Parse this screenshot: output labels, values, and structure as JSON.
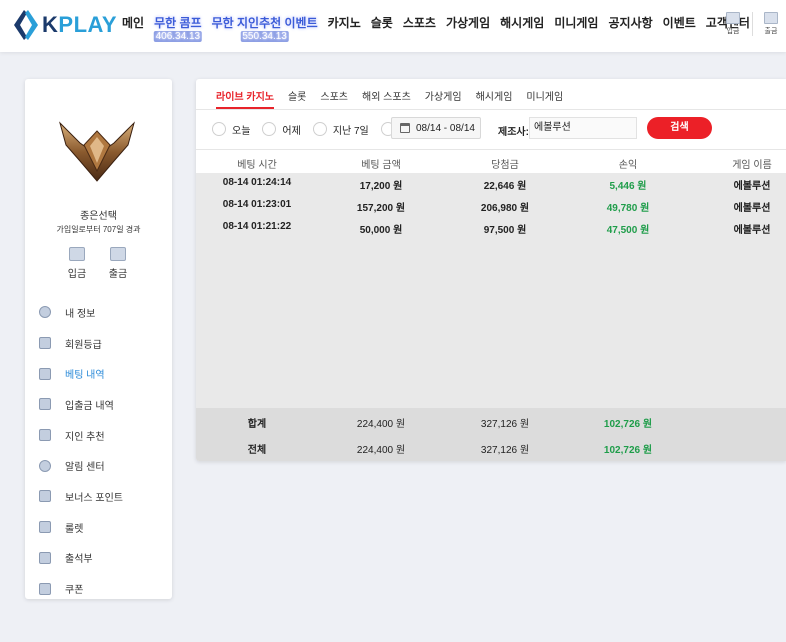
{
  "header": {
    "logo_text_k": "K",
    "logo_text_play": "PLAY",
    "nav": [
      {
        "label": "메인"
      },
      {
        "label": "무한 콤프",
        "sub": "406.34.13"
      },
      {
        "label": "무한 지인추천 이벤트",
        "sub": "550.34.13"
      },
      {
        "label": "카지노"
      },
      {
        "label": "슬롯"
      },
      {
        "label": "스포츠"
      },
      {
        "label": "가상게임"
      },
      {
        "label": "해시게임"
      },
      {
        "label": "미니게임"
      },
      {
        "label": "공지사항"
      },
      {
        "label": "이벤트"
      },
      {
        "label": "고객센터"
      }
    ],
    "deposit_label": "입금",
    "withdraw_label": "출금"
  },
  "sidebar": {
    "user_name": "종은선택",
    "user_sub": "가입일로부터 707일 경과",
    "deposit_label": "입금",
    "withdraw_label": "출금",
    "menu": [
      {
        "label": "내 정보",
        "icon": "user-icon"
      },
      {
        "label": "회원등급",
        "icon": "rank-icon"
      },
      {
        "label": "베팅 내역",
        "icon": "betting-icon",
        "active": true
      },
      {
        "label": "입출금 내역",
        "icon": "wallet-icon"
      },
      {
        "label": "지인 추천",
        "icon": "referral-icon"
      },
      {
        "label": "알림 센터",
        "icon": "bell-icon"
      },
      {
        "label": "보너스 포인트",
        "icon": "points-icon"
      },
      {
        "label": "룰렛",
        "icon": "roulette-icon"
      },
      {
        "label": "출석부",
        "icon": "attendance-icon"
      },
      {
        "label": "쿠폰",
        "icon": "coupon-icon"
      }
    ]
  },
  "tabs": [
    {
      "label": "라이브 카지노",
      "active": true
    },
    {
      "label": "슬롯"
    },
    {
      "label": "스포츠"
    },
    {
      "label": "해외 스포츠"
    },
    {
      "label": "가상게임"
    },
    {
      "label": "해시게임"
    },
    {
      "label": "미니게임"
    }
  ],
  "filters": {
    "today": "오늘",
    "yesterday": "어제",
    "last7": "지난 7일",
    "date_range": "08/14 - 08/14",
    "provider_label": "제조사:",
    "provider_value": "에볼루션",
    "search_label": "검색"
  },
  "table": {
    "headers": [
      "베팅 시간",
      "베팅 금액",
      "당첨금",
      "손익",
      "게임 이름"
    ],
    "rows": [
      [
        "08-14 01:24:14",
        "17,200 원",
        "22,646 원",
        "5,446 원",
        "에볼루션"
      ],
      [
        "08-14 01:23:01",
        "157,200 원",
        "206,980 원",
        "49,780 원",
        "에볼루션"
      ],
      [
        "08-14 01:21:22",
        "50,000 원",
        "97,500 원",
        "47,500 원",
        "에볼루션"
      ]
    ],
    "footer": [
      [
        "합계",
        "224,400 원",
        "327,126 원",
        "102,726 원"
      ],
      [
        "전체",
        "224,400 원",
        "327,126 원",
        "102,726 원"
      ]
    ]
  },
  "colors": {
    "accent_red": "#ec2027",
    "profit_green": "#1f9d4a",
    "active_menu_blue": "#2a8ad8"
  }
}
